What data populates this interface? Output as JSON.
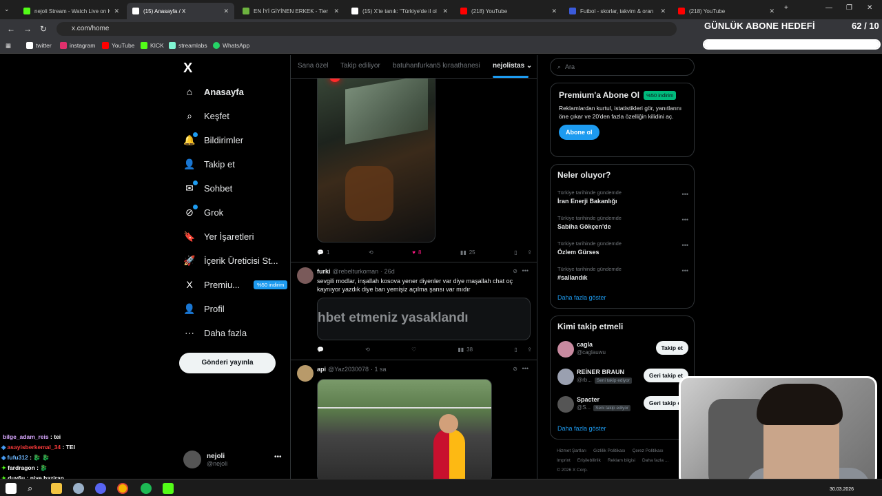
{
  "browser": {
    "tabs": [
      {
        "label": "nejoli Stream - Watch Live on K",
        "color": "#53fc18"
      },
      {
        "label": "(15) Anasayfa / X",
        "color": "#ffffff"
      },
      {
        "label": "EN İYİ GİYİNEN ERKEK - Tier Li",
        "color": "#6db33f"
      },
      {
        "label": "(15) X'te tanık: \"Türkiye'de il ol",
        "color": "#ffffff"
      },
      {
        "label": "(218) YouTube",
        "color": "#ff0000"
      },
      {
        "label": "Futbol - skorlar, takvim & oran",
        "color": "#3b5bdb"
      },
      {
        "label": "(218) YouTube",
        "color": "#ff0000"
      }
    ],
    "url": "x.com/home",
    "bookmarks": [
      {
        "label": "twitter",
        "color": "#ffffff"
      },
      {
        "label": "instagram",
        "color": "#e1306c"
      },
      {
        "label": "YouTube",
        "color": "#ff0000"
      },
      {
        "label": "KICK",
        "color": "#53fc18"
      },
      {
        "label": "streamlabs",
        "color": "#80f5d2"
      },
      {
        "label": "WhatsApp",
        "color": "#25d366"
      }
    ]
  },
  "goal": {
    "title": "GÜNLÜK ABONE HEDEFİ",
    "count": "62 / 10",
    "progress": 1.0
  },
  "nav": {
    "logo": "X",
    "items": [
      {
        "label": "Anasayfa",
        "icon": "⌂"
      },
      {
        "label": "Keşfet",
        "icon": "⌕"
      },
      {
        "label": "Bildirimler",
        "icon": "🔔"
      },
      {
        "label": "Takip et",
        "icon": "👤"
      },
      {
        "label": "Sohbet",
        "icon": "✉"
      },
      {
        "label": "Grok",
        "icon": "⊘"
      },
      {
        "label": "Yer İşaretleri",
        "icon": "🔖"
      },
      {
        "label": "İçerik Üreticisi St...",
        "icon": "🚀"
      },
      {
        "label": "Premiu...",
        "icon": "X",
        "badge": "%50 indirim"
      },
      {
        "label": "Profil",
        "icon": "👤"
      },
      {
        "label": "Daha fazla",
        "icon": "⋯"
      }
    ],
    "post_button": "Gönderi yayınla",
    "user": {
      "name": "nejoli",
      "handle": "@nejoli"
    }
  },
  "feed": {
    "tabs": [
      "Sana özel",
      "Takip ediliyor",
      "batuhanfurkan5 kıraathanesi",
      "nejolistas"
    ],
    "post1": {
      "replies": "1",
      "likes": "8",
      "views": "25"
    },
    "post2": {
      "name": "furki",
      "handle": "@rebelturkoman",
      "time": "· 26d",
      "text": "sevgili modlar, inşallah kosova yener diyenler var diye maşallah chat oç kaynıyor yazdık diye ban yemişiz açılma şansı var mıdır",
      "quote": "hbet etmeniz yasaklandı",
      "views": "38"
    },
    "post3": {
      "name": "api",
      "handle": "@Yaz2030078",
      "time": "· 1 sa"
    }
  },
  "right": {
    "search_placeholder": "Ara",
    "premium": {
      "title": "Premium'a Abone Ol",
      "badge": "%50 indirim",
      "desc": "Reklamlardan kurtul, istatistikleri gör, yanıtlarını öne çıkar ve 20'den fazla özelliğin kilidini aç.",
      "button": "Abone ol"
    },
    "trends": {
      "title": "Neler oluyor?",
      "items": [
        {
          "context": "Türkiye tarihinde gündemde",
          "name": "İran Enerji Bakanlığı"
        },
        {
          "context": "Türkiye tarihinde gündemde",
          "name": "Sabiha Gökçen'de"
        },
        {
          "context": "Türkiye tarihinde gündemde",
          "name": "Özlem Gürses"
        },
        {
          "context": "Türkiye tarihinde gündemde",
          "name": "#sallandık"
        }
      ],
      "more": "Daha fazla göster"
    },
    "who_to_follow": {
      "title": "Kimi takip etmeli",
      "items": [
        {
          "name": "cagla",
          "handle": "@caglauwu",
          "button": "Takip et",
          "tag": ""
        },
        {
          "name": "REİNER BRAUN",
          "handle": "@rb...",
          "button": "Geri takip et",
          "tag": "Seni takip ediyor"
        },
        {
          "name": "Spacter",
          "handle": "@S...",
          "button": "Geri takip et",
          "tag": "Seni takip ediyor"
        }
      ],
      "more": "Daha fazla göster"
    },
    "footer": [
      "Hizmet Şartları",
      "Gizlilik Politikası",
      "Çerez Politikası",
      "Imprint",
      "Erişilebilirlik",
      "Reklam bilgisi",
      "Daha fazla ...",
      "© 2026 X Corp."
    ]
  },
  "chat": [
    {
      "name": "bilge_adam_reis",
      "msg": ": tei",
      "color": "#d9a8ff"
    },
    {
      "name": "asayisberkemal_34",
      "msg": ": TEI",
      "color": "#ff3b3b"
    },
    {
      "name": "fufu312",
      "msg": ": 🐉 🐉",
      "color": "#6fb8ff"
    },
    {
      "name": "fardragon",
      "msg": ": 🐉",
      "color": "#ffffff"
    },
    {
      "name": "duy6u",
      "msg": ": niye haziran",
      "color": "#ffffff"
    }
  ],
  "taskbar": {
    "date": "30.03.2026"
  }
}
